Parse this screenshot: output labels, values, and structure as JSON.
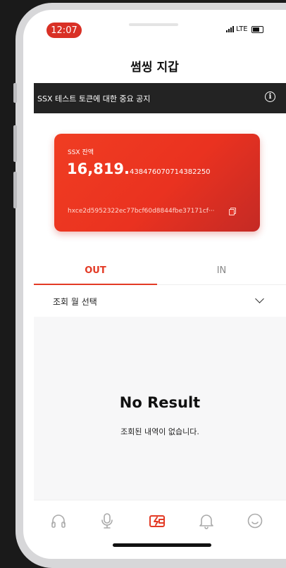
{
  "status_bar": {
    "time": "12:07",
    "network": "LTE"
  },
  "header": {
    "title": "썸씽 지갑"
  },
  "notice": {
    "text": "SSX 테스트 토큰에 대한 중요 공지",
    "icon": "info-icon"
  },
  "wallet_card": {
    "label": "SSX 잔액",
    "amount_integer": "16,819.",
    "amount_decimal": "438476070714382250",
    "address": "hxce2d5952322ec77bcf60d8844fbe37171cf···",
    "copy_icon": "copy-icon",
    "gradient_start": "#f03d22",
    "gradient_end": "#c42a25"
  },
  "tabs": [
    {
      "label": "OUT",
      "active": true
    },
    {
      "label": "IN",
      "active": false
    }
  ],
  "month_select": {
    "label": "조회 월 선택"
  },
  "empty_state": {
    "title": "No Result",
    "subtitle": "조회된 내역이 없습니다."
  },
  "bottom_nav": [
    {
      "icon": "headphones-icon",
      "active": false
    },
    {
      "icon": "microphone-icon",
      "active": false
    },
    {
      "icon": "wallet-icon",
      "active": true
    },
    {
      "icon": "bell-icon",
      "active": false
    },
    {
      "icon": "smile-icon",
      "active": false
    }
  ],
  "colors": {
    "accent": "#e33a25",
    "notice_bg": "#232323",
    "inactive_icon": "#aaaaaa"
  }
}
